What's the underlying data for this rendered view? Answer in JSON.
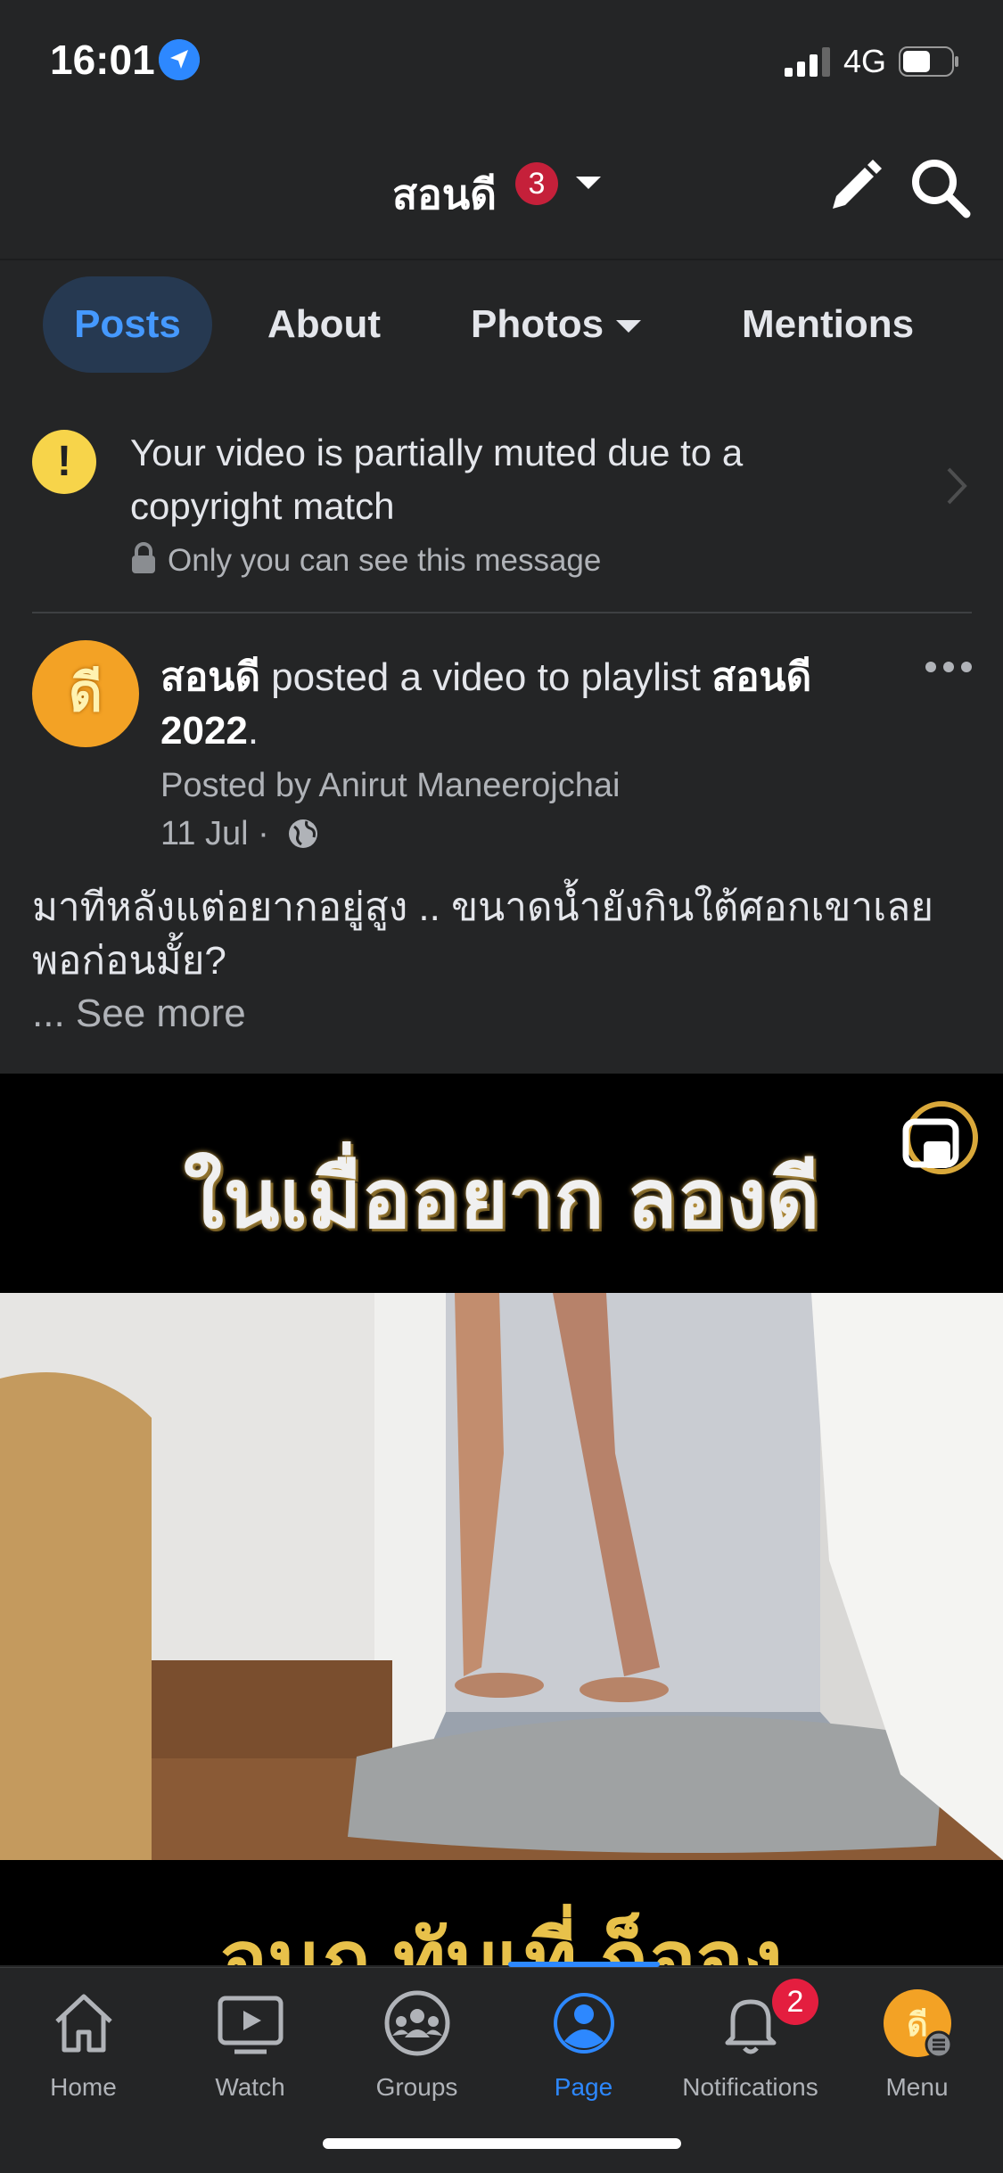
{
  "status_bar": {
    "time": "16:01",
    "network": "4G"
  },
  "header": {
    "title": "สอนดี",
    "badge_count": "3"
  },
  "tabs": [
    {
      "label": "Posts"
    },
    {
      "label": "About"
    },
    {
      "label": "Photos"
    },
    {
      "label": "Mentions"
    }
  ],
  "notice": {
    "message": "Your video is partially muted due to a copyright match",
    "privacy": "Only you can see this message"
  },
  "post": {
    "author": "สอนดี",
    "action": " posted a video to playlist ",
    "playlist": "สอนดี 2022",
    "end": ".",
    "posted_by": "Posted by Anirut Maneerojchai",
    "date": "11 Jul",
    "date_sep": " · ",
    "caption": "มาทีหลังแต่อยากอยู่สูง .. ขนาดน้ำยังกินใต้ศอกเขาเลย พอก่อนมั้ย?",
    "see_more": "... See more",
    "video_title": "ในเมื่ออยาก ลองดี",
    "video_subtitle": "จนก ทับเที่ ถ็อจง"
  },
  "bottom_nav": [
    {
      "label": "Home",
      "icon": "home-icon"
    },
    {
      "label": "Watch",
      "icon": "watch-icon"
    },
    {
      "label": "Groups",
      "icon": "groups-icon"
    },
    {
      "label": "Page",
      "icon": "page-icon"
    },
    {
      "label": "Notifications",
      "icon": "bell-icon",
      "badge": "2"
    },
    {
      "label": "Menu",
      "icon": "menu-avatar-icon"
    }
  ],
  "colors": {
    "background": "#242526",
    "accent": "#2d88ff",
    "badge": "#e41e3f",
    "warning": "#f7d44a",
    "avatar": "#f3a225"
  }
}
